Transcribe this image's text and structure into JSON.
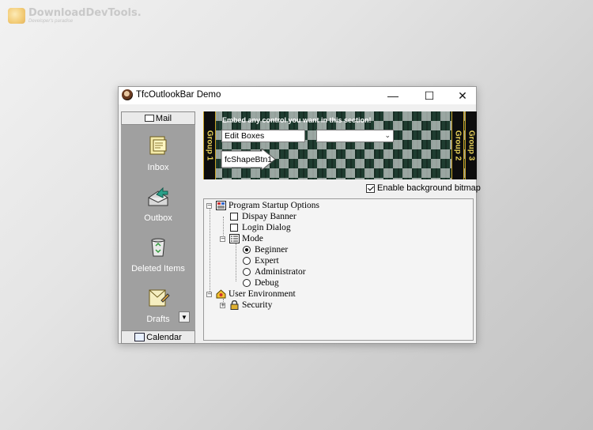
{
  "watermark": {
    "title": "DownloadDevTools.",
    "subtitle": "Developer's paradise"
  },
  "window": {
    "title": "TfcOutlookBar Demo",
    "minimize": "—",
    "maximize": "☐",
    "close": "✕"
  },
  "outlook_bar": {
    "groups": [
      {
        "label": "Mail",
        "icon": "mail-icon"
      },
      {
        "label": "Calendar",
        "icon": "calendar-icon"
      }
    ],
    "items": [
      {
        "label": "Inbox",
        "icon": "inbox-icon"
      },
      {
        "label": "Outbox",
        "icon": "outbox-icon"
      },
      {
        "label": "Deleted Items",
        "icon": "recycle-bin-icon"
      },
      {
        "label": "Drafts",
        "icon": "drafts-icon"
      }
    ],
    "scroll_down": "▼"
  },
  "banner": {
    "text": "Embed any control you want in this section!",
    "edit_value": "Edit Boxes",
    "combo_value": "",
    "shape_button": "fcShapeBtn1",
    "tabs": [
      "Group 1",
      "Group 2",
      "Group 3"
    ]
  },
  "options": {
    "enable_bitmap_label": "Enable background bitmap",
    "enable_bitmap_checked": true
  },
  "tree": {
    "program_startup": "Program Startup Options",
    "display_banner": "Dispay Banner",
    "login_dialog": "Login Dialog",
    "mode": "Mode",
    "beginner": "Beginner",
    "expert": "Expert",
    "administrator": "Administrator",
    "debug": "Debug",
    "user_env": "User Environment",
    "security": "Security",
    "collapse": "−",
    "expand": "+"
  }
}
